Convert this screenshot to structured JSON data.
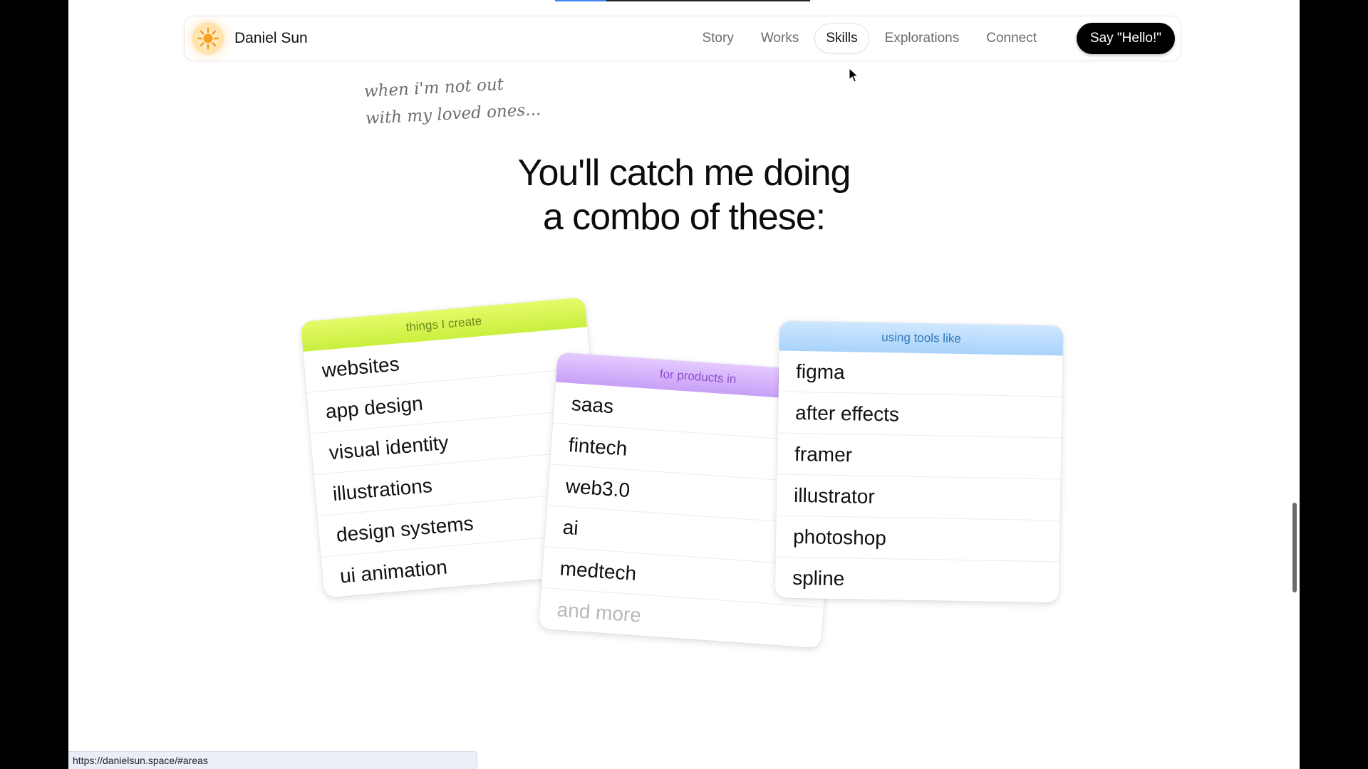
{
  "progress": {
    "value": 0.2
  },
  "nav": {
    "brand": {
      "name": "Daniel Sun",
      "logo_icon": "sun-icon"
    },
    "links": [
      "Story",
      "Works",
      "Skills",
      "Explorations",
      "Connect"
    ],
    "active_link": "Skills",
    "cta": "Say \"Hello!\""
  },
  "intro": {
    "note_line1": "when i'm not out",
    "note_line2": "with my loved ones...",
    "heading_line1": "You'll catch me doing",
    "heading_line2": "a combo of these:"
  },
  "cards": {
    "create": {
      "header": "things I create",
      "color": "#d4f54a",
      "items": [
        "websites",
        "app design",
        "visual identity",
        "illustrations",
        "design systems",
        "ui animation"
      ]
    },
    "products": {
      "header": "for products in",
      "color": "#d3b0fb",
      "items": [
        "saas",
        "fintech",
        "web3.0",
        "ai",
        "medtech",
        "and more"
      ]
    },
    "tools": {
      "header": "using tools like",
      "color": "#b8dcfc",
      "items": [
        "figma",
        "after effects",
        "framer",
        "illustrator",
        "photoshop",
        "spline"
      ]
    }
  },
  "status_bar": {
    "url": "https://danielsun.space/#areas"
  }
}
